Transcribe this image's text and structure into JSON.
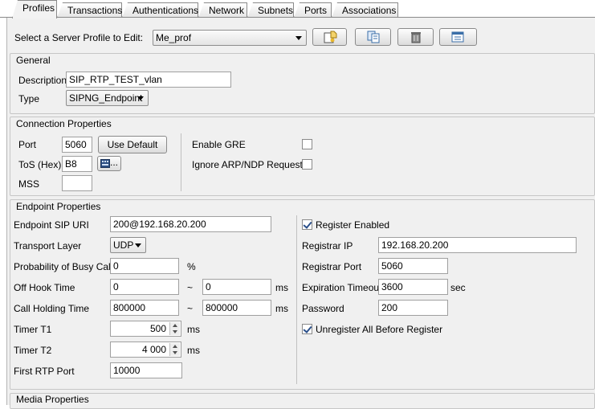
{
  "tabs": [
    {
      "label": "Profiles",
      "active": true
    },
    {
      "label": "Transactions",
      "active": false
    },
    {
      "label": "Authentications",
      "active": false
    },
    {
      "label": "Network",
      "active": false
    },
    {
      "label": "Subnets",
      "active": false
    },
    {
      "label": "Ports",
      "active": false
    },
    {
      "label": "Associations",
      "active": false
    }
  ],
  "profile_select": {
    "label": "Select a Server Profile to Edit:",
    "value": "Me_prof",
    "buttons": [
      {
        "icon": "new-profile-icon"
      },
      {
        "icon": "copy-profile-icon"
      },
      {
        "icon": "delete-trash-icon"
      },
      {
        "icon": "rename-profile-icon"
      }
    ]
  },
  "general": {
    "header": "General",
    "description_label": "Description",
    "description_value": "SIP_RTP_TEST_vlan",
    "type_label": "Type",
    "type_value": "SIPNG_Endpoint"
  },
  "connection": {
    "header": "Connection Properties",
    "port_label": "Port",
    "port_value": "5060",
    "use_default_label": "Use Default",
    "tos_label": "ToS (Hex)",
    "tos_value": "B8",
    "tos_button_label": "...",
    "mss_label": "MSS",
    "mss_value": "",
    "enable_gre_label": "Enable GRE",
    "enable_gre_checked": false,
    "ignore_arp_label": "Ignore ARP/NDP Requests",
    "ignore_arp_checked": false
  },
  "endpoint": {
    "header": "Endpoint Properties",
    "sip_uri_label": "Endpoint SIP URI",
    "sip_uri_value": "200@192.168.20.200",
    "transport_label": "Transport Layer",
    "transport_value": "UDP",
    "busy_label": "Probability of Busy Calls",
    "busy_value": "0",
    "busy_unit": "%",
    "offhook_label": "Off Hook Time",
    "offhook_min": "0",
    "offhook_max": "0",
    "offhook_unit": "ms",
    "holding_label": "Call Holding Time",
    "holding_min": "800000",
    "holding_max": "800000",
    "holding_unit": "ms",
    "tilde": "~",
    "t1_label": "Timer T1",
    "t1_value": "500",
    "t1_unit": "ms",
    "t2_label": "Timer T2",
    "t2_value": "4 000",
    "t2_unit": "ms",
    "rtp_port_label": "First RTP Port",
    "rtp_port_value": "10000",
    "register_enabled_label": "Register Enabled",
    "register_enabled_checked": true,
    "registrar_ip_label": "Registrar IP",
    "registrar_ip_value": "192.168.20.200",
    "registrar_port_label": "Registrar Port",
    "registrar_port_value": "5060",
    "expiration_label": "Expiration Timeout",
    "expiration_value": "3600",
    "expiration_unit": "sec",
    "password_label": "Password",
    "password_value": "200",
    "unregister_label": "Unregister All Before Register",
    "unregister_checked": true
  },
  "media": {
    "header": "Media Properties"
  },
  "colors": {
    "panel_bg": "#f0f0f0",
    "border": "#8a8a8a",
    "check": "#2a4f8a"
  }
}
